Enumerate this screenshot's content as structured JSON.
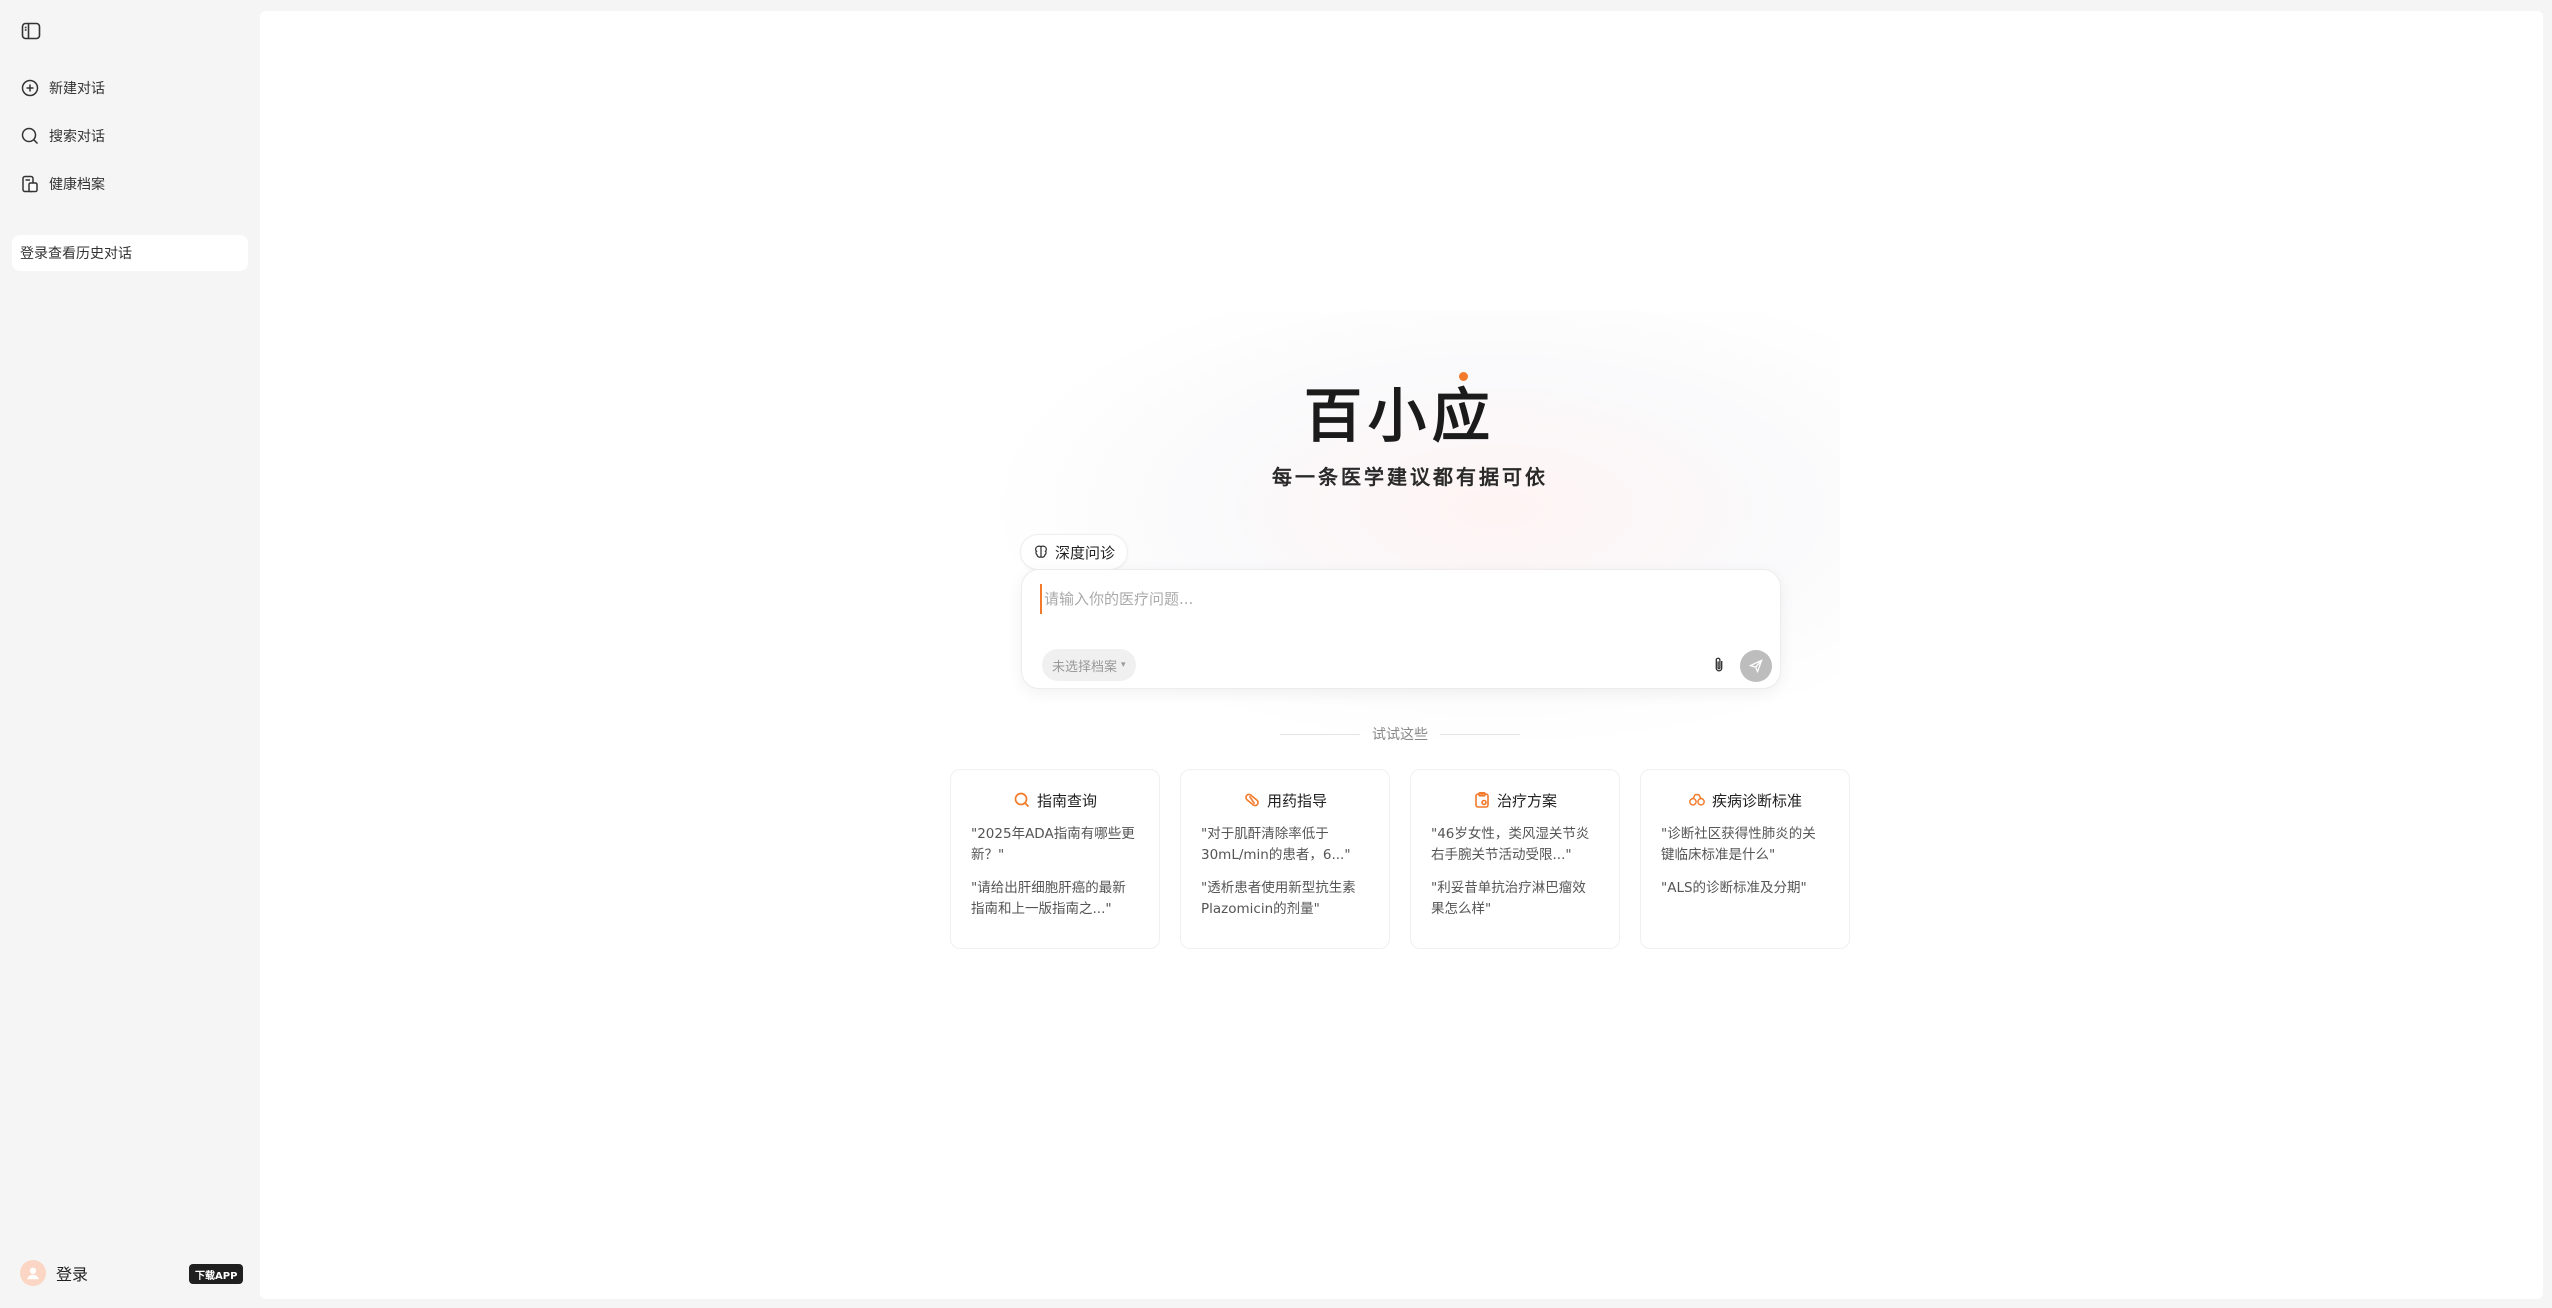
{
  "sidebar": {
    "items": [
      {
        "label": "新建对话",
        "icon": "plus-circle-icon"
      },
      {
        "label": "搜索对话",
        "icon": "search-chat-icon"
      },
      {
        "label": "健康档案",
        "icon": "health-record-icon"
      }
    ],
    "history_prompt": "登录查看历史对话",
    "login_label": "登录",
    "download_badge": "下载APP"
  },
  "main": {
    "logo": "百小应",
    "tagline": "每一条医学建议都有据可依",
    "mode_chip": "深度问诊",
    "input_placeholder": "请输入你的医疗问题...",
    "profile_select": "未选择档案",
    "try_label": "试试这些",
    "cards": [
      {
        "title": "指南查询",
        "icon": "search-icon",
        "questions": [
          "\"2025年ADA指南有哪些更新？\"",
          "\"请给出肝细胞肝癌的最新指南和上一版指南之...\""
        ]
      },
      {
        "title": "用药指导",
        "icon": "pill-icon",
        "questions": [
          "\"对于肌酐清除率低于30mL/min的患者，6...\"",
          "\"透析患者使用新型抗生素Plazomicin的剂量\""
        ]
      },
      {
        "title": "治疗方案",
        "icon": "clipboard-icon",
        "questions": [
          "\"46岁女性，类风湿关节炎右手腕关节活动受限...\"",
          "\"利妥昔单抗治疗淋巴瘤效果怎么样\""
        ]
      },
      {
        "title": "疾病诊断标准",
        "icon": "diagnosis-icon",
        "questions": [
          "\"诊断社区获得性肺炎的关键临床标准是什么\"",
          "\"ALS的诊断标准及分期\""
        ]
      }
    ]
  },
  "colors": {
    "accent": "#f27a2a",
    "send_disabled": "#bdbdbd"
  }
}
